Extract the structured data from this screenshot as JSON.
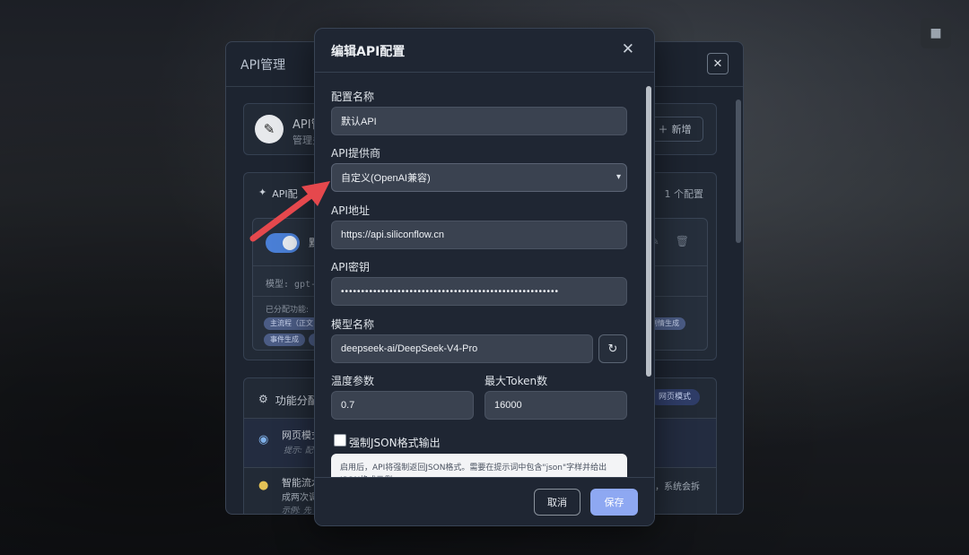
{
  "background": {
    "corner_icon": "square-icon"
  },
  "back_panel": {
    "title": "API管理",
    "close_icon": "close-icon",
    "header_card": {
      "title": "API管",
      "subtitle": "管理多",
      "add_label": "新增"
    },
    "config_card": {
      "title": "API配",
      "count_label": "1 个配置",
      "item": {
        "name": "默",
        "model_label": "模型: gpt-",
        "assigned_label": "已分配功能:",
        "tags": [
          "主流程（正文",
          "事件生成",
          "",
          "剧情生成"
        ]
      }
    },
    "feature_card": {
      "title": "功能分配",
      "badge": "网页模式",
      "web_title": "网页模式",
      "web_hint": "提示: 配",
      "web_right": "。",
      "smart_title": "智能流水",
      "smart_sub": "成两次调",
      "smart_hint": "示例: 先",
      "smart_right": "，系统会拆"
    }
  },
  "modal": {
    "title": "编辑API配置",
    "close": "✕",
    "fields": {
      "config_name": {
        "label": "配置名称",
        "value": "默认API"
      },
      "provider": {
        "label": "API提供商",
        "value": "自定义(OpenAI兼容)"
      },
      "url": {
        "label": "API地址",
        "value": "https://api.siliconflow.cn"
      },
      "key": {
        "label": "API密钥",
        "value": "••••••••••••••••••••••••••••••••••••••••••••••••••••••"
      },
      "model": {
        "label": "模型名称",
        "value": "deepseek-ai/DeepSeek-V4-Pro"
      },
      "temperature": {
        "label": "温度参数",
        "value": "0.7"
      },
      "max_tokens": {
        "label": "最大Token数",
        "value": "16000"
      }
    },
    "force_json": {
      "label": "强制JSON格式输出",
      "checked": false
    },
    "info_text": "启用后，API将强制返回JSON格式。需要在提示词中包含\"json\"字样并给出JSON格式示例。",
    "buttons": {
      "cancel": "取消",
      "save": "保存"
    }
  },
  "colors": {
    "accent": "#8ea8f2",
    "toggle_on": "#4a7fd6",
    "annotation_arrow": "#e5484d"
  }
}
